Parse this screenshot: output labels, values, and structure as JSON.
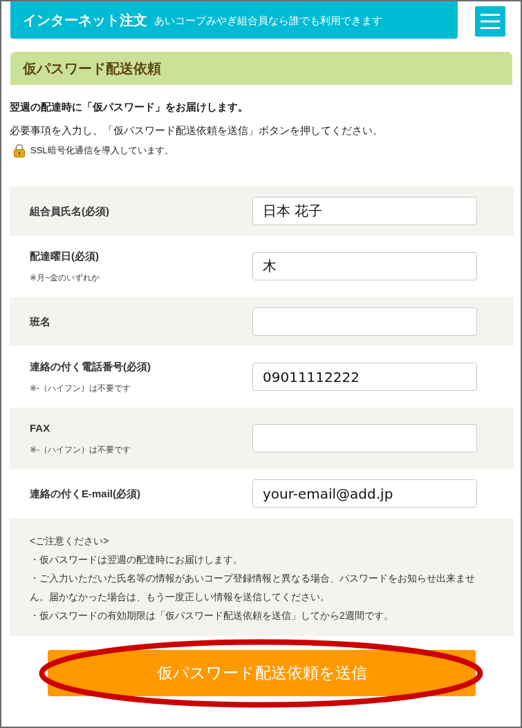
{
  "header": {
    "title": "インターネット注文",
    "subtitle": "あいコープみやぎ組合員なら誰でも利用できます"
  },
  "page_heading": "仮パスワード配送依頼",
  "intro": {
    "lead": "翌週の配達時に「仮パスワード」をお届けします。",
    "instruction": "必要事項を入力し、「仮パスワード配送依頼を送信」ボタンを押してください。",
    "security_note": "SSL暗号化通信を導入しています。"
  },
  "form": {
    "fields": [
      {
        "label": "組合員氏名(必須)",
        "value": "日本 花子"
      },
      {
        "label": "配達曜日(必須)",
        "note": "※月~金のいずれか",
        "value": "木"
      },
      {
        "label": "班名"
      },
      {
        "label": "連絡の付く電話番号(必須)",
        "note": "※-（ハイフン）は不要です",
        "value": "09011112222"
      },
      {
        "label": "FAX",
        "note": "※-（ハイフン）は不要です"
      },
      {
        "label": "連絡の付くE-mail(必須)",
        "value": "your-email@add.jp"
      }
    ]
  },
  "notice": {
    "heading": "<ご注意ください>",
    "items": [
      "・仮パスワードは翌週の配達時にお届けします。",
      "・ご入力いただいた氏名等の情報があいコープ登録情報と異なる場合、パスワードをお知らせ出来ません。届かなかった場合は、もう一度正しい情報を送信してください。",
      "・仮パスワードの有効期限は「仮パスワード配送依頼を送信」してから2週間です。"
    ]
  },
  "submit_button": {
    "label": "仮パスワード配送依頼を送信",
    "highlighted": true
  }
}
